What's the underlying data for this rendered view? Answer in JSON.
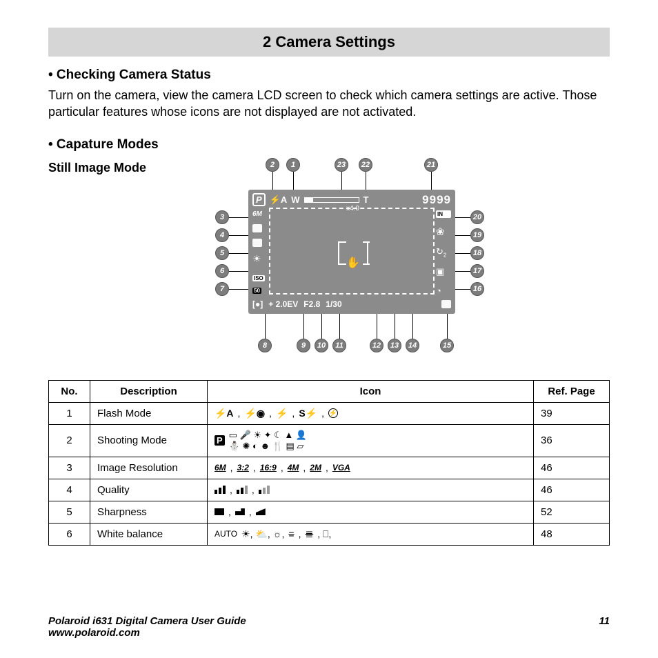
{
  "chapter_title": "2 Camera Settings",
  "section1": {
    "heading": "• Checking Camera Status",
    "body": "Turn on the camera, view the camera LCD screen to check which camera settings are active. Those particular features whose icons are not displayed are not activated."
  },
  "section2": {
    "heading": "• Capature Modes",
    "subheading": "Still Image Mode"
  },
  "lcd": {
    "p_badge": "P",
    "flash_auto": "⚡A",
    "zoom_w": "W",
    "zoom_t": "T",
    "zoom_label": "x4.0",
    "shots_left": "9999",
    "resolution": "6M",
    "iso_label": "ISO",
    "iso_value": "50",
    "meter_icon": "[●]",
    "ev": "+ 2.0EV",
    "fstop": "F2.8",
    "shutter": "1/30",
    "in_label": "IN",
    "self_timer_sub": "2"
  },
  "callouts": [
    "1",
    "2",
    "3",
    "4",
    "5",
    "6",
    "7",
    "8",
    "9",
    "10",
    "11",
    "12",
    "13",
    "14",
    "15",
    "16",
    "17",
    "18",
    "19",
    "20",
    "21",
    "22",
    "23"
  ],
  "table": {
    "headers": {
      "no": "No.",
      "desc": "Description",
      "icon": "Icon",
      "ref": "Ref. Page"
    },
    "rows": [
      {
        "no": "1",
        "desc": "Flash Mode",
        "icons_text": "⚡A, ⚡◉, ⚡, S⚡, ⊘",
        "ref": "39"
      },
      {
        "no": "2",
        "desc": "Shooting Mode",
        "icons_text": "P ▭ 🎤 ☀ ✦ ☾ ▲ 👤  ⛄ ✺ ◐ ☻ 🍴 ▤ ▱",
        "ref": "36"
      },
      {
        "no": "3",
        "desc": "Image Resolution",
        "icons_text": "6M, 3:2, 16:9, 4M, 2M, VGA",
        "ref": "46"
      },
      {
        "no": "4",
        "desc": "Quality",
        "icons_text": "qbars",
        "ref": "46"
      },
      {
        "no": "5",
        "desc": "Sharpness",
        "icons_text": "sharp",
        "ref": "52"
      },
      {
        "no": "6",
        "desc": "White balance",
        "icons_text": "AUTO ☀, ⛅, ☼, ≡, ≣, ⎕,",
        "ref": "48"
      }
    ]
  },
  "footer": {
    "title": "Polaroid i631 Digital Camera User Guide",
    "url": "www.polaroid.com",
    "page": "11"
  }
}
